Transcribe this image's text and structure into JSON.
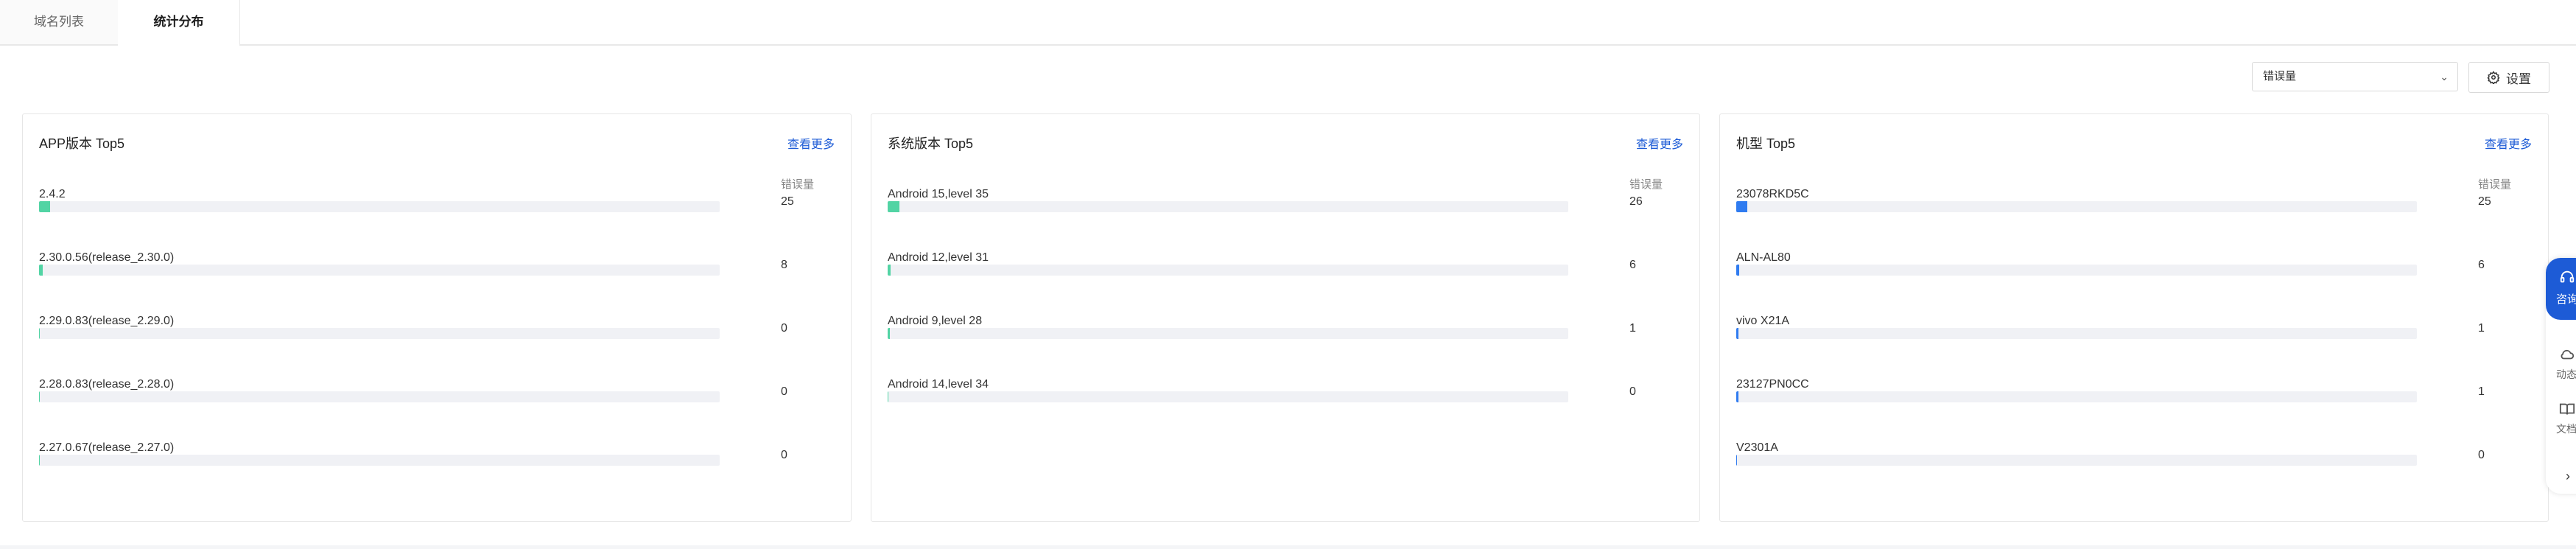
{
  "tabs": [
    "域名列表",
    "统计分布"
  ],
  "toolbar": {
    "metric_select": "错误量",
    "settings_label": "设置"
  },
  "cards": [
    {
      "title": "APP版本 Top5",
      "more": "查看更多",
      "column_header": "错误量",
      "bar_color": "#52d4a4",
      "rows": [
        {
          "label": "2.4.2",
          "value": "25"
        },
        {
          "label": "2.30.0.56(release_2.30.0)",
          "value": "8"
        },
        {
          "label": "2.29.0.83(release_2.29.0)",
          "value": "0"
        },
        {
          "label": "2.28.0.83(release_2.28.0)",
          "value": "0"
        },
        {
          "label": "2.27.0.67(release_2.27.0)",
          "value": "0"
        }
      ]
    },
    {
      "title": "系统版本 Top5",
      "more": "查看更多",
      "column_header": "错误量",
      "bar_color": "#52d4a4",
      "rows": [
        {
          "label": "Android 15,level 35",
          "value": "26"
        },
        {
          "label": "Android 12,level 31",
          "value": "6"
        },
        {
          "label": "Android 9,level 28",
          "value": "1"
        },
        {
          "label": "Android 14,level 34",
          "value": "0"
        }
      ]
    },
    {
      "title": "机型 Top5",
      "more": "查看更多",
      "column_header": "错误量",
      "bar_color": "#2f7bf0",
      "rows": [
        {
          "label": "23078RKD5C",
          "value": "25"
        },
        {
          "label": "ALN-AL80",
          "value": "6"
        },
        {
          "label": "vivo X21A",
          "value": "1"
        },
        {
          "label": "23127PN0CC",
          "value": "1"
        },
        {
          "label": "V2301A",
          "value": "0"
        }
      ]
    }
  ],
  "side_panel": {
    "consult": "咨询",
    "dynamic": "动态",
    "docs": "文档"
  }
}
